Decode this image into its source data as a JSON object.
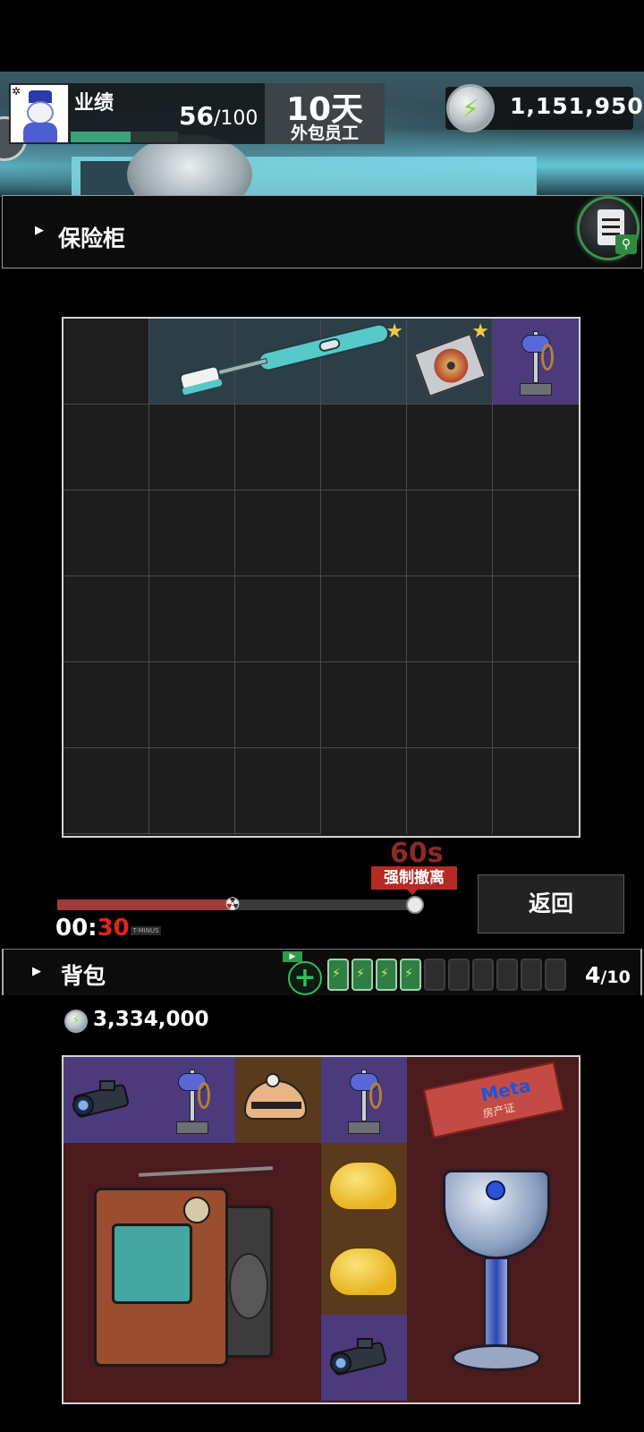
{
  "hud": {
    "performance_label": "业绩",
    "performance_current": "56",
    "performance_max": "/100",
    "performance_fraction": 0.56,
    "days": "10天",
    "role": "外包员工",
    "coins": "1,151,950"
  },
  "safe": {
    "title": "保险柜",
    "items": [
      {
        "name": "toothbrush",
        "starred": true
      },
      {
        "name": "cd",
        "starred": true
      },
      {
        "name": "sword-trophy",
        "starred": false
      }
    ]
  },
  "evacuation": {
    "countdown": "60s",
    "force_label": "强制撤离",
    "timer_prefix": "00:",
    "timer_seconds": "30",
    "tminus_label": "T-MINUS",
    "progress": 0.49,
    "back_label": "返回"
  },
  "backpack": {
    "title": "背包",
    "batteries_full": 4,
    "batteries_total": 10,
    "count_current": "4",
    "count_total": "/10",
    "coins": "3,334,000",
    "deed_logo": "Meta",
    "deed_text": "房产证"
  },
  "colors": {
    "accent_green": "#2fbf5a",
    "force_red": "#b52a24",
    "timer_red": "#e0241e"
  }
}
